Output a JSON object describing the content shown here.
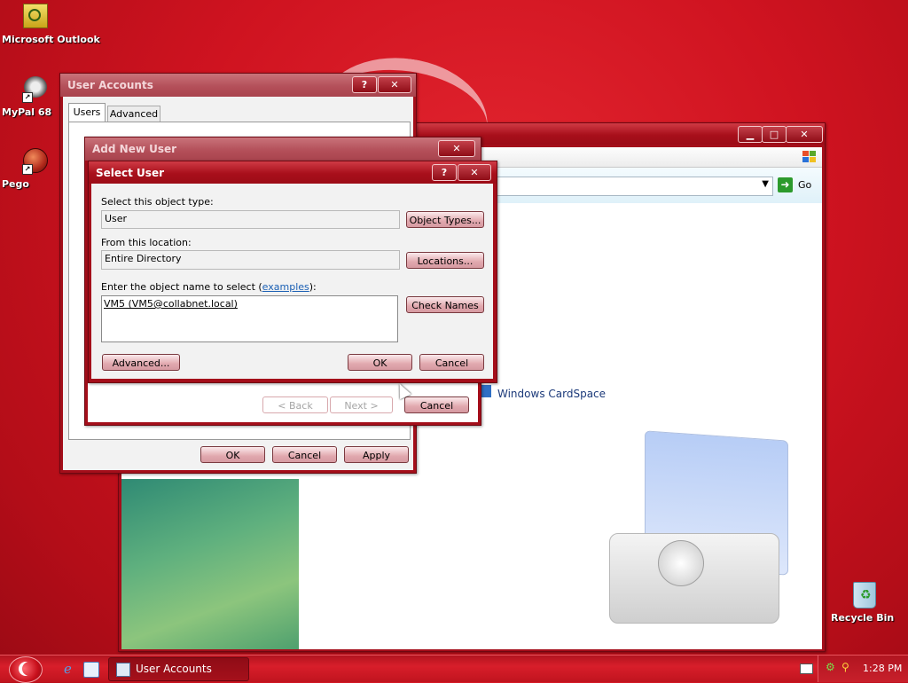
{
  "desktop": {
    "icons": [
      {
        "label": "Microsoft Outlook",
        "icon": "outlook-icon"
      },
      {
        "label": "MyPal 68",
        "icon": "mypal-icon"
      },
      {
        "label": "Pego",
        "icon": "pego-icon"
      },
      {
        "label": "Recycle Bin",
        "icon": "recycle-bin-icon"
      }
    ]
  },
  "control_panel": {
    "go_label": "Go",
    "cardspace_label": "Windows CardSpace"
  },
  "user_accounts": {
    "title": "User Accounts",
    "tabs": [
      "Users",
      "Advanced"
    ],
    "ok": "OK",
    "cancel": "Cancel",
    "apply": "Apply"
  },
  "add_new_user": {
    "title": "Add New User",
    "back": "< Back",
    "next": "Next >",
    "cancel": "Cancel"
  },
  "select_user": {
    "title": "Select User",
    "object_type_label": "Select this object type:",
    "object_type_value": "User",
    "object_types_button": "Object Types...",
    "location_label": "From this location:",
    "location_value": "Entire Directory",
    "locations_button": "Locations...",
    "enter_label_prefix": "Enter the object name to select (",
    "examples_link": "examples",
    "enter_label_suffix": "):",
    "object_name_value": "VM5 (VM5@collabnet.local)",
    "check_names_button": "Check Names",
    "advanced_button": "Advanced...",
    "ok": "OK",
    "cancel": "Cancel"
  },
  "taskbar": {
    "task_label": "User Accounts",
    "clock": "1:28 PM"
  },
  "colors": {
    "desktop_red": "#cf1320",
    "title_red": "#a80f1b",
    "link_blue": "#1a5fb4"
  }
}
